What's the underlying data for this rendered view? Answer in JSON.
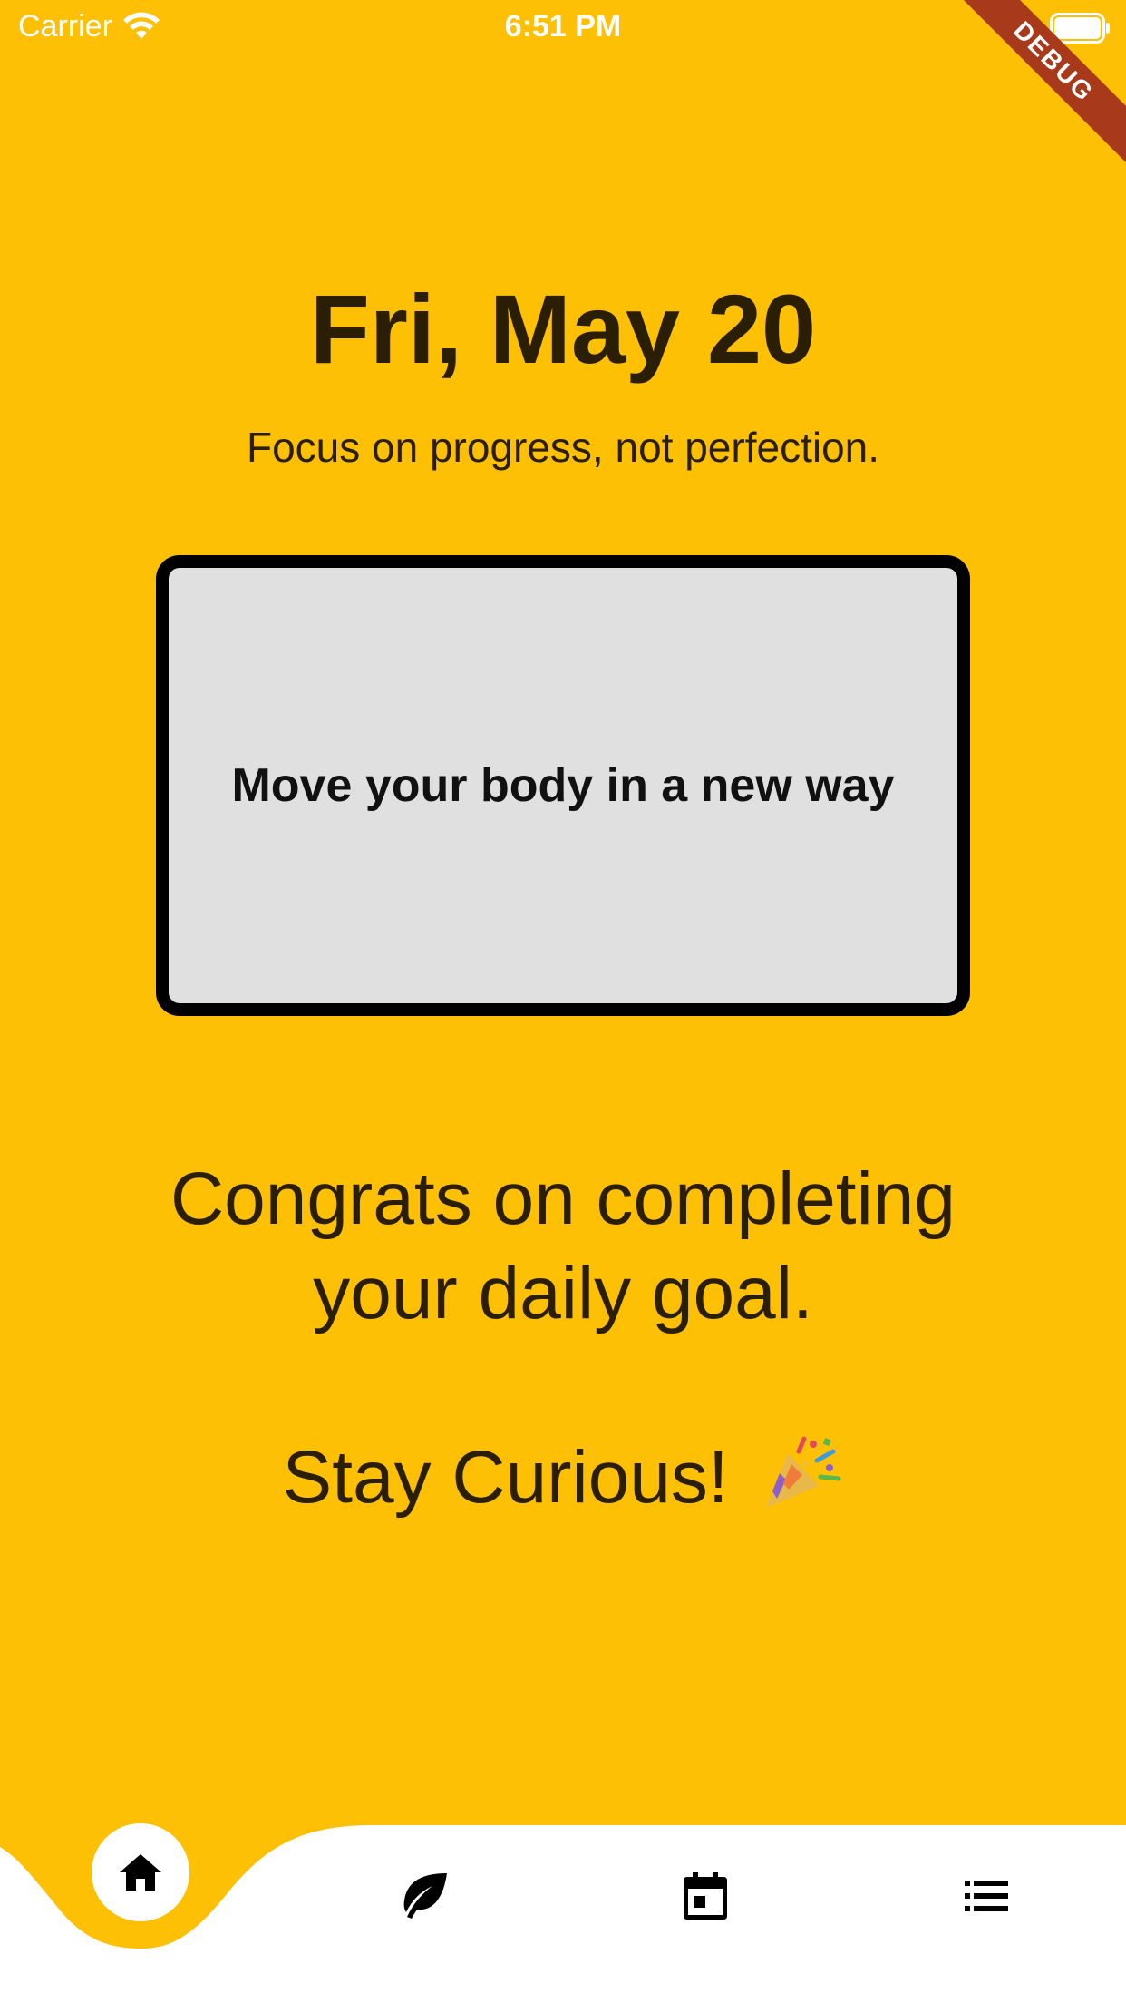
{
  "status_bar": {
    "carrier": "Carrier",
    "time": "6:51 PM",
    "icons": [
      "wifi-icon",
      "battery-icon"
    ]
  },
  "debug_banner": {
    "label": "DEBUG",
    "color": "#A83A1B"
  },
  "main": {
    "date": "Fri, May 20",
    "quote": "Focus on progress, not perfection.",
    "task": "Move your body in a new way",
    "congrats": "Congrats on completing your daily goal.",
    "sign_off": "Stay Curious!",
    "sign_off_icon": "party-popper-icon"
  },
  "bottom_nav": {
    "items": [
      {
        "icon": "home-icon",
        "active": true
      },
      {
        "icon": "leaf-icon",
        "active": false
      },
      {
        "icon": "calendar-icon",
        "active": false
      },
      {
        "icon": "list-icon",
        "active": false
      }
    ]
  },
  "colors": {
    "background": "#FDC005",
    "text": "#2A1E05",
    "card": "#E0E0E0",
    "card_border": "#000000",
    "nav_background": "#FFFFFF"
  }
}
